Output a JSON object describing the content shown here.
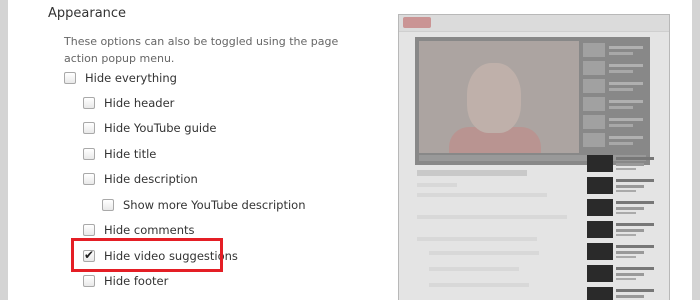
{
  "section": {
    "title": "Appearance",
    "hint": "These options can also be toggled using the page action popup menu."
  },
  "options": [
    {
      "label": "Hide everything",
      "checked": false
    },
    {
      "label": "Hide header",
      "checked": false
    },
    {
      "label": "Hide YouTube guide",
      "checked": false
    },
    {
      "label": "Hide title",
      "checked": false
    },
    {
      "label": "Hide description",
      "checked": false
    },
    {
      "label": "Show more YouTube description",
      "checked": false
    },
    {
      "label": "Hide comments",
      "checked": false
    },
    {
      "label": "Hide video suggestions",
      "checked": true
    },
    {
      "label": "Hide footer",
      "checked": false
    }
  ],
  "colors": {
    "highlight": "#e41e25"
  }
}
